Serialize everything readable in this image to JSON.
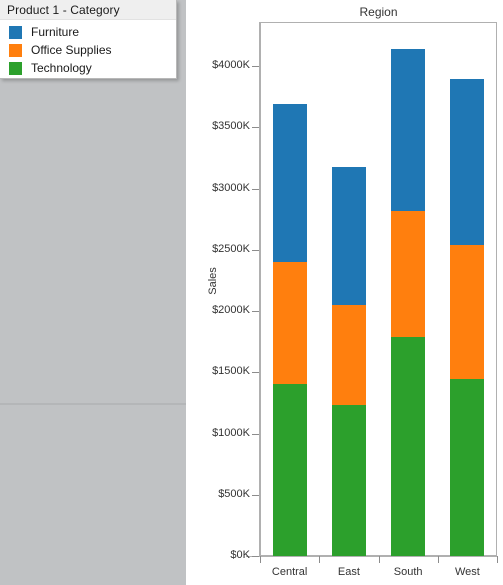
{
  "legend": {
    "title": "Product 1 - Category",
    "items": [
      {
        "label": "Furniture",
        "color": "#1f77b4"
      },
      {
        "label": "Office Supplies",
        "color": "#ff7f0e"
      },
      {
        "label": "Technology",
        "color": "#2ca02c"
      }
    ]
  },
  "chart_data": {
    "type": "bar",
    "subtype": "stacked",
    "title": "Region",
    "xlabel": "",
    "ylabel": "Sales",
    "categories": [
      "Central",
      "East",
      "South",
      "West"
    ],
    "series": [
      {
        "name": "Technology",
        "color": "#2ca02c",
        "values": [
          1404,
          1233,
          1788,
          1445
        ]
      },
      {
        "name": "Office Supplies",
        "color": "#ff7f0e",
        "values": [
          996,
          816,
          1028,
          1094
        ]
      },
      {
        "name": "Furniture",
        "color": "#1f77b4",
        "values": [
          1290,
          1127,
          1323,
          1355
        ]
      }
    ],
    "stack_order_bottom_to_top": [
      "Technology",
      "Office Supplies",
      "Furniture"
    ],
    "totals": [
      3690,
      3176,
      4139,
      3894
    ],
    "ylim": [
      0,
      4200
    ],
    "ytick_values": [
      0,
      500,
      1000,
      1500,
      2000,
      2500,
      3000,
      3500,
      4000
    ],
    "ytick_labels": [
      "$0K",
      "$500K",
      "$1000K",
      "$1500K",
      "$2000K",
      "$2500K",
      "$3000K",
      "$3500K",
      "$4000K"
    ],
    "grid": false,
    "legend_position": "floating-top-left",
    "axis_line_color": "#b0b0b0",
    "background": "#ffffff"
  }
}
